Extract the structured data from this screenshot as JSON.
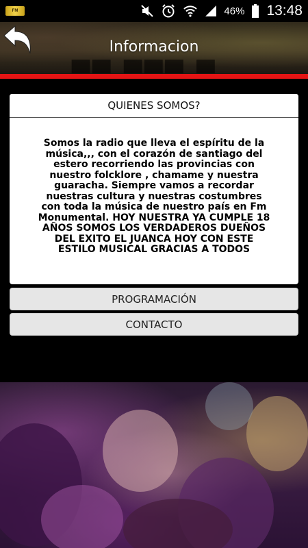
{
  "status_bar": {
    "battery_percent": "46%",
    "time": "13:48",
    "icons": [
      "mute-icon",
      "alarm-icon",
      "wifi-icon",
      "signal-icon",
      "battery-icon"
    ]
  },
  "header": {
    "title": "Informacion",
    "back_icon": "back-arrow-icon"
  },
  "card": {
    "heading": "QUIENES SOMOS?",
    "body": "Somos la radio que lleva el espíritu de la música,,, con el corazón de santiago del estero recorriendo las provincias con nuestro folcklore , chamame y nuestra guaracha. Siempre vamos a recordar nuestras cultura y nuestras costumbres con toda la música de nuestro país en Fm Monumental. HOY NUESTRA YA CUMPLE 18 AÑOS SOMOS LOS VERDADEROS DUEÑOS DEL EXITO EL JUANCA HOY CON ESTE ESTILO MUSICAL GRACIAS A TODOS"
  },
  "menu": {
    "programacion": "PROGRAMACIÓN",
    "contacto": "CONTACTO"
  },
  "colors": {
    "accent_red": "#e41414",
    "button_bg": "#e6e6e6"
  }
}
